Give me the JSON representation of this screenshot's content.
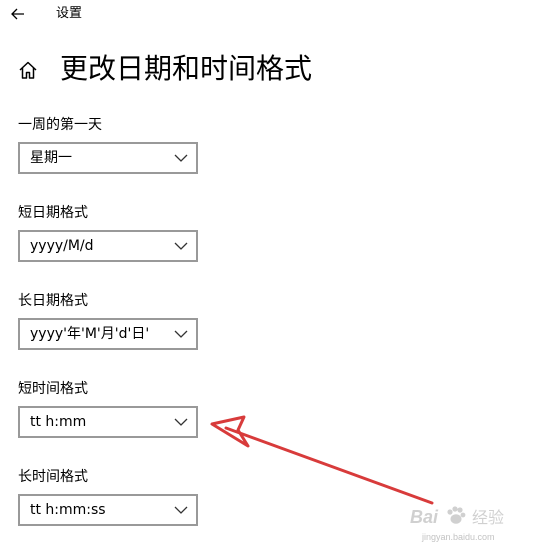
{
  "window": {
    "title": "设置"
  },
  "page": {
    "title": "更改日期和时间格式"
  },
  "fields": [
    {
      "label": "一周的第一天",
      "value": "星期一"
    },
    {
      "label": "短日期格式",
      "value": "yyyy/M/d"
    },
    {
      "label": "长日期格式",
      "value": "yyyy'年'M'月'd'日'"
    },
    {
      "label": "短时间格式",
      "value": "tt h:mm"
    },
    {
      "label": "长时间格式",
      "value": "tt h:mm:ss"
    }
  ],
  "icons": {
    "back": "back-arrow-icon",
    "home": "home-icon",
    "dropdown": "chevron-down-icon"
  },
  "watermark": {
    "brand": "Bai",
    "product": "经验",
    "url": "jingyan.baidu.com"
  },
  "colors": {
    "annotation_arrow": "#d83b3b",
    "dropdown_border": "#999999",
    "text": "#000000"
  }
}
